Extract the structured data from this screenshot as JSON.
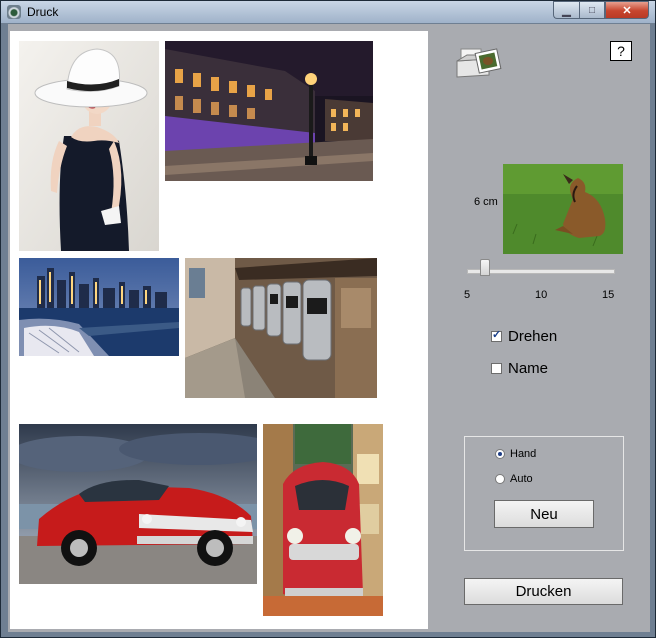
{
  "window": {
    "title": "Druck",
    "controls": [
      "minimize",
      "maximize",
      "close"
    ]
  },
  "photos": [
    {
      "subject": "woman in white hat"
    },
    {
      "subject": "city square at night"
    },
    {
      "subject": "city skyline at dusk"
    },
    {
      "subject": "row of payphones"
    },
    {
      "subject": "red classic car on beach"
    },
    {
      "subject": "red vintage car in street"
    }
  ],
  "panel": {
    "help_label": "?",
    "printer_icon": "printer-icon",
    "size_label": "6 cm",
    "preview_subject": "dog on grass",
    "slider": {
      "min": 5,
      "max": 15,
      "value": 6,
      "ticks": [
        "5",
        "10",
        "15"
      ]
    },
    "checkboxes": [
      {
        "label": "Drehen",
        "checked": true
      },
      {
        "label": "Name",
        "checked": false
      }
    ],
    "mode": {
      "options": [
        {
          "label": "Hand",
          "selected": true
        },
        {
          "label": "Auto",
          "selected": false
        }
      ],
      "new_button": "Neu"
    },
    "print_button": "Drucken"
  }
}
